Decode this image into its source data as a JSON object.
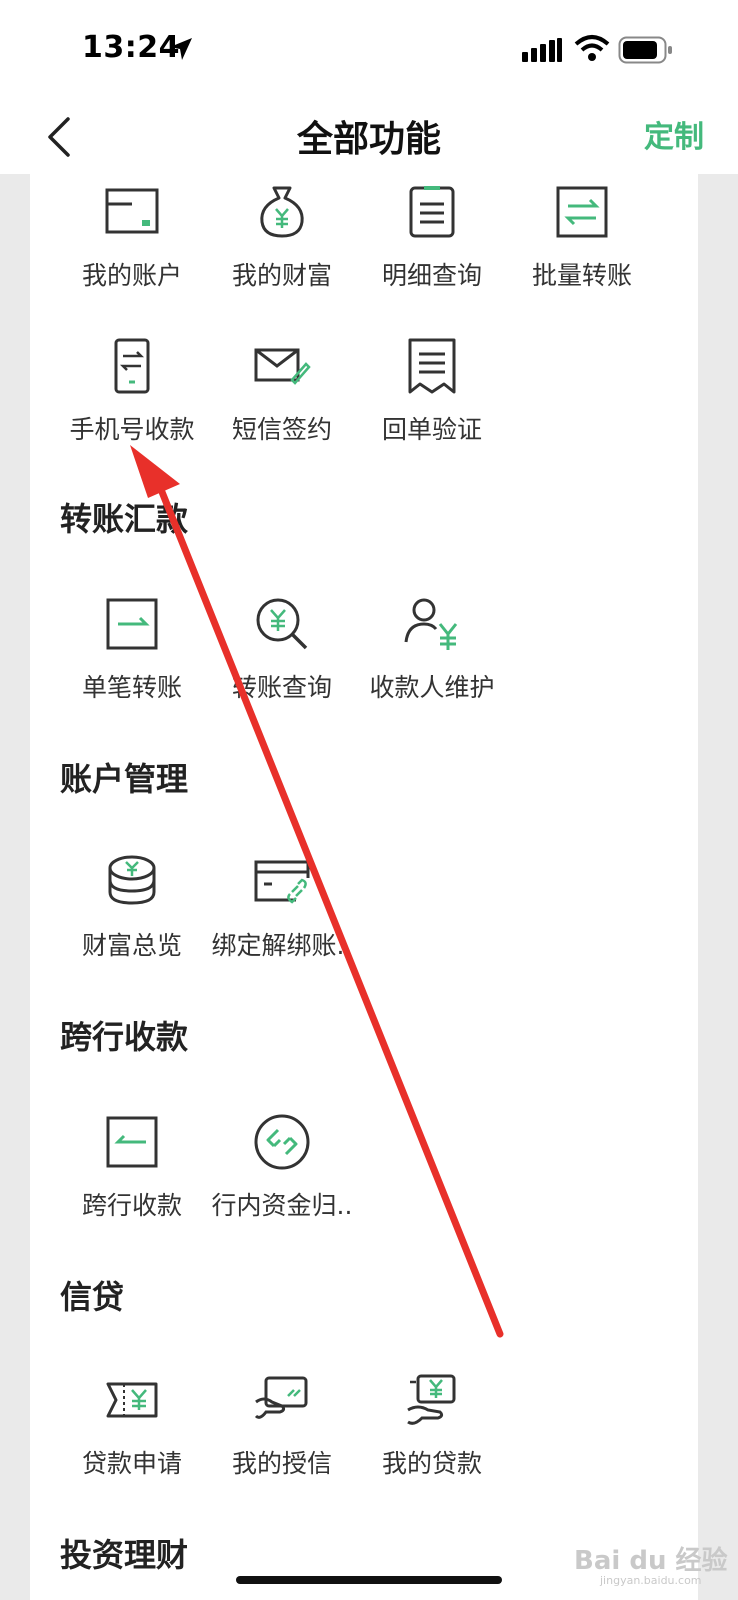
{
  "status_bar": {
    "time": "13:24"
  },
  "nav": {
    "title": "全部功能",
    "customize_label": "定制"
  },
  "colors": {
    "accent": "#44b97c",
    "icon_stroke": "#333333",
    "arrow": "#e8302a"
  },
  "top_items": [
    {
      "label": "我的账户",
      "icon": "account-card-icon"
    },
    {
      "label": "我的财富",
      "icon": "money-bag-icon"
    },
    {
      "label": "明细查询",
      "icon": "clipboard-list-icon"
    },
    {
      "label": "批量转账",
      "icon": "batch-transfer-icon"
    },
    {
      "label": "手机号收款",
      "icon": "phone-transfer-icon"
    },
    {
      "label": "短信签约",
      "icon": "sms-envelope-icon"
    },
    {
      "label": "回单验证",
      "icon": "receipt-icon"
    }
  ],
  "sections": [
    {
      "title": "转账汇款",
      "items": [
        {
          "label": "单笔转账",
          "icon": "single-transfer-icon"
        },
        {
          "label": "转账查询",
          "icon": "transfer-query-icon"
        },
        {
          "label": "收款人维护",
          "icon": "payee-icon"
        }
      ]
    },
    {
      "title": "账户管理",
      "items": [
        {
          "label": "财富总览",
          "icon": "coins-stack-icon"
        },
        {
          "label": "绑定解绑账..",
          "icon": "bind-card-icon"
        }
      ]
    },
    {
      "title": "跨行收款",
      "items": [
        {
          "label": "跨行收款",
          "icon": "interbank-receive-icon"
        },
        {
          "label": "行内资金归..",
          "icon": "fund-collect-icon"
        }
      ]
    },
    {
      "title": "信贷",
      "items": [
        {
          "label": "贷款申请",
          "icon": "loan-apply-icon"
        },
        {
          "label": "我的授信",
          "icon": "credit-card-hand-icon"
        },
        {
          "label": "我的贷款",
          "icon": "my-loan-icon"
        }
      ]
    },
    {
      "title": "投资理财",
      "items": []
    }
  ],
  "watermark": {
    "main": "Bai du 经验",
    "sub": "jingyan.baidu.com"
  }
}
